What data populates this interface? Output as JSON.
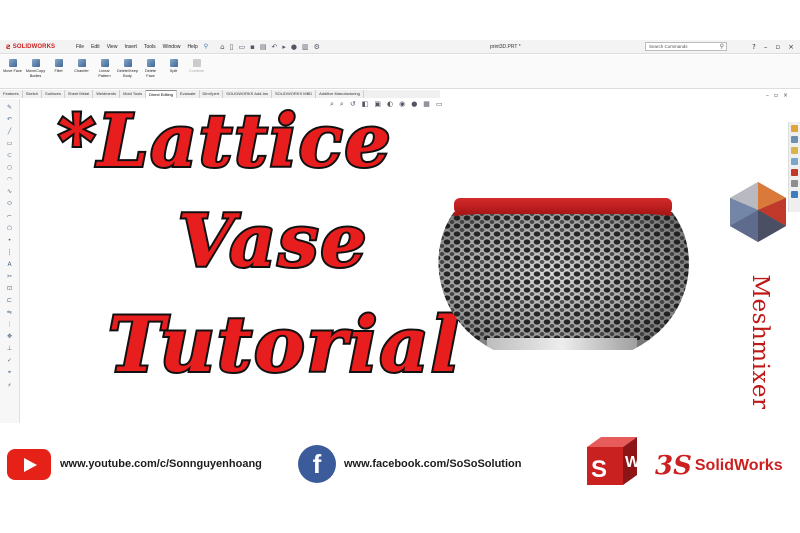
{
  "app": {
    "brand": "SOLIDWORKS",
    "document_title": "print3D.PRT *"
  },
  "menubar": {
    "items": [
      "File",
      "Edit",
      "View",
      "Insert",
      "Tools",
      "Window",
      "Help"
    ]
  },
  "search": {
    "placeholder": "Search Commands"
  },
  "ribbon": {
    "tools": [
      {
        "label": "Move Face",
        "enabled": true
      },
      {
        "label": "Move/Copy Bodies",
        "enabled": true
      },
      {
        "label": "Fillet",
        "enabled": true
      },
      {
        "label": "Chamfer",
        "enabled": true
      },
      {
        "label": "Linear Pattern",
        "enabled": true
      },
      {
        "label": "Delete/Keep Body",
        "enabled": true
      },
      {
        "label": "Delete Face",
        "enabled": true
      },
      {
        "label": "Split",
        "enabled": true
      },
      {
        "label": "Combine",
        "enabled": false
      }
    ]
  },
  "command_tabs": [
    "Features",
    "Sketch",
    "Surfaces",
    "Sheet Metal",
    "Weldments",
    "Mold Tools",
    "Direct Editing",
    "Evaluate",
    "DimXpert",
    "SOLIDWORKS Add-Ins",
    "SOLIDWORKS MBD",
    "Additive Manufacturing"
  ],
  "active_tab": "Direct Editing",
  "thumbnail": {
    "title_lines": [
      "*Lattice",
      "Vase",
      "Tutorial"
    ],
    "side_text": "Meshmixer"
  },
  "footer": {
    "youtube": "www.youtube.com/c/Sonnguyenhoang",
    "facebook": "www.facebook.com/SoSoSolution",
    "facebook_glyph": "f",
    "brand_text": "SolidWorks",
    "brand_logo": "3S",
    "cube_letters": [
      "S",
      "W"
    ]
  },
  "colors": {
    "accent_red": "#cc1f1f",
    "title_red": "#e81d1d",
    "youtube_red": "#e62117",
    "facebook_blue": "#3b5b9a"
  }
}
